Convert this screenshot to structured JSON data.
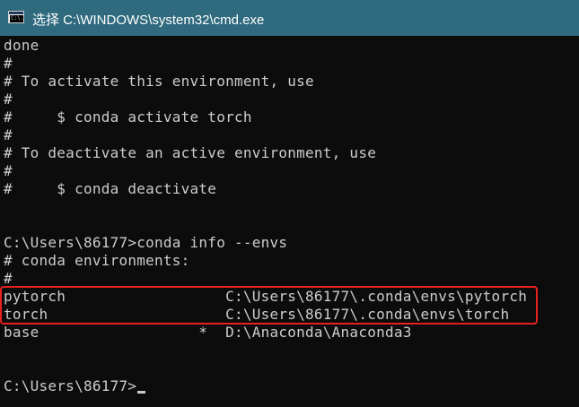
{
  "window": {
    "title": "选择 C:\\WINDOWS\\system32\\cmd.exe",
    "icon": "cmd-prompt-icon",
    "icon_glyph": "C:\\."
  },
  "terminal": {
    "lines": [
      "done",
      "#",
      "# To activate this environment, use",
      "#",
      "#     $ conda activate torch",
      "#",
      "# To deactivate an active environment, use",
      "#",
      "#     $ conda deactivate",
      "",
      "",
      "C:\\Users\\86177>conda info --envs",
      "# conda environments:",
      "#",
      "pytorch                  C:\\Users\\86177\\.conda\\envs\\pytorch",
      "torch                    C:\\Users\\86177\\.conda\\envs\\torch",
      "base                  *  D:\\Anaconda\\Anaconda3",
      "",
      "",
      "C:\\Users\\86177>"
    ]
  },
  "colors": {
    "titlebar": "#2f6a7e",
    "background": "#0c0c0c",
    "text": "#cccccc",
    "highlight": "#e8201f"
  }
}
